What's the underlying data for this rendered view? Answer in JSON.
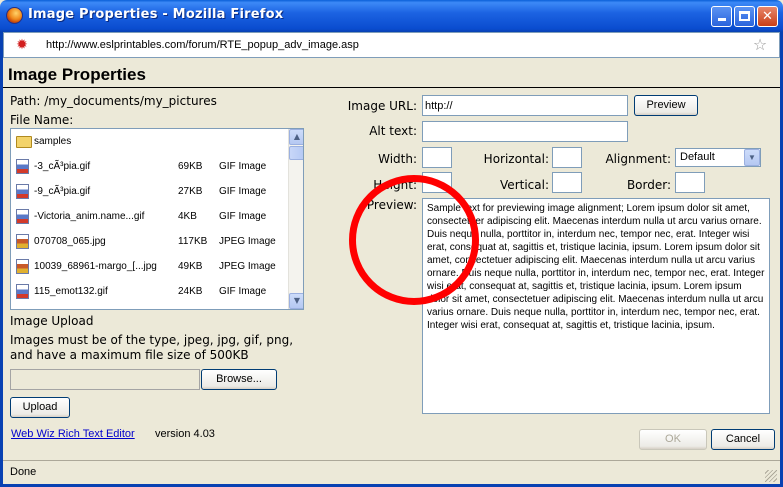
{
  "window": {
    "title": "Image Properties - Mozilla Firefox",
    "minimize_icon": "minimize-icon",
    "maximize_icon": "maximize-icon",
    "close_label": "✕"
  },
  "urlbar": {
    "url": "http://www.eslprintables.com/forum/RTE_popup_adv_image.asp"
  },
  "page": {
    "title": "Image Properties",
    "path_label": "Path: /my_documents/my_pictures",
    "file_name_label": "File Name:",
    "files": [
      {
        "name": "samples",
        "size": "",
        "type": "",
        "icon": "folder-icon"
      },
      {
        "name": "-3_cÃ³pia.gif",
        "size": "69KB",
        "type": "GIF Image",
        "icon": "gif-file-icon"
      },
      {
        "name": "-9_cÃ³pia.gif",
        "size": "27KB",
        "type": "GIF Image",
        "icon": "gif-file-icon"
      },
      {
        "name": "-Victoria_anim.name...gif",
        "size": "4KB",
        "type": "GIF Image",
        "icon": "gif-file-icon"
      },
      {
        "name": "070708_065.jpg",
        "size": "117KB",
        "type": "JPEG Image",
        "icon": "jpeg-file-icon"
      },
      {
        "name": "10039_68961-margo_[...jpg",
        "size": "49KB",
        "type": "JPEG Image",
        "icon": "jpeg-file-icon"
      },
      {
        "name": "115_emot132.gif",
        "size": "24KB",
        "type": "GIF Image",
        "icon": "gif-file-icon"
      }
    ],
    "upload": {
      "title": "Image Upload",
      "note": "Images must be of the type, jpeg, jpg, gif, png, and have a maximum file size of 500KB",
      "browse_label": "Browse...",
      "upload_label": "Upload"
    },
    "form": {
      "image_url_label": "Image URL:",
      "image_url_value": "http://",
      "preview_button": "Preview",
      "alt_text_label": "Alt text:",
      "alt_text_value": "",
      "width_label": "Width:",
      "height_label": "Height:",
      "horizontal_label": "Horizontal:",
      "vertical_label": "Vertical:",
      "alignment_label": "Alignment:",
      "alignment_value": "Default",
      "border_label": "Border:",
      "preview_label": "Preview:",
      "preview_text": "Sample text for previewing image alignment; Lorem ipsum dolor sit amet, consectetuer adipiscing elit. Maecenas interdum nulla ut arcu varius ornare. Duis neque nulla, porttitor in, interdum nec, tempor nec, erat. Integer wisi erat, consequat at, sagittis et, tristique lacinia, ipsum. Lorem ipsum dolor sit amet, consectetuer adipiscing elit. Maecenas interdum nulla ut arcu varius ornare. Duis neque nulla, porttitor in, interdum nec, tempor nec, erat. Integer wisi erat, consequat at, sagittis et, tristique lacinia, ipsum. Lorem ipsum dolor sit amet, consectetuer adipiscing elit. Maecenas interdum nulla ut arcu varius ornare. Duis neque nulla, porttitor in, interdum nec, tempor nec, erat. Integer wisi erat, consequat at, sagittis et, tristique lacinia, ipsum."
    },
    "footer": {
      "link_text": "Web Wiz Rich Text Editor",
      "version_text": "version 4.03",
      "ok_label": "OK",
      "cancel_label": "Cancel"
    }
  },
  "status": {
    "text": "Done"
  },
  "colors": {
    "titlebar": "#0a4ccf",
    "annotation": "#ff0000",
    "link": "#0000cc"
  }
}
